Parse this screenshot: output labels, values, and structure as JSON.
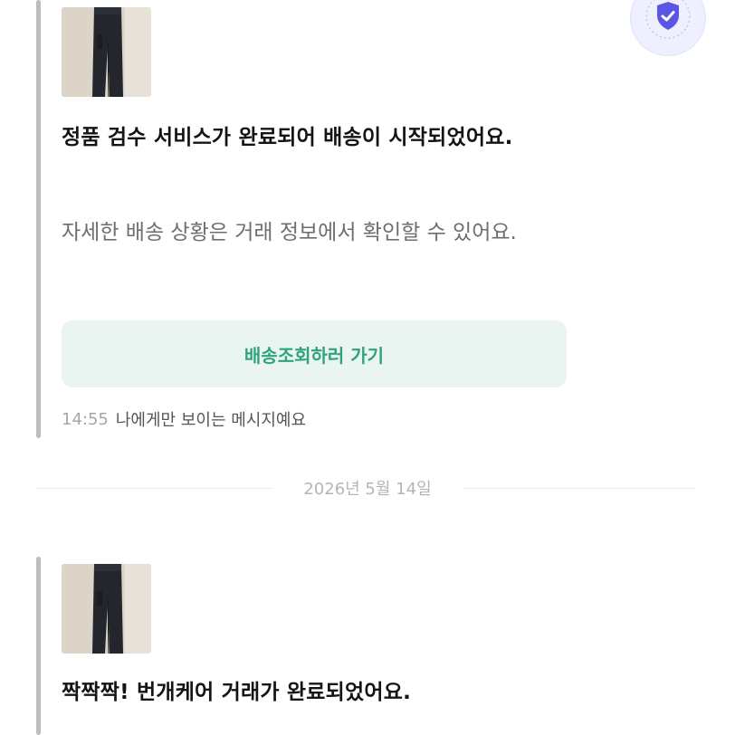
{
  "messages": [
    {
      "title": "정품 검수 서비스가 완료되어 배송이 시작되었어요.",
      "description": "자세한 배송 상황은 거래 정보에서 확인할 수 있어요.",
      "button_label": "배송조회하러 가기",
      "time": "14:55",
      "visibility_note": "나에게만 보이는 메시지예요"
    },
    {
      "title": "짝짝짝! 번개케어 거래가 완료되었어요."
    }
  ],
  "date_divider": "2026년 5월 14일",
  "badge": {
    "icon": "shield-check-icon",
    "color": "#5b55e6"
  },
  "colors": {
    "accent_green": "#2fa37b",
    "cta_background": "#eaf5f1",
    "bar": "#bdbdbd"
  }
}
